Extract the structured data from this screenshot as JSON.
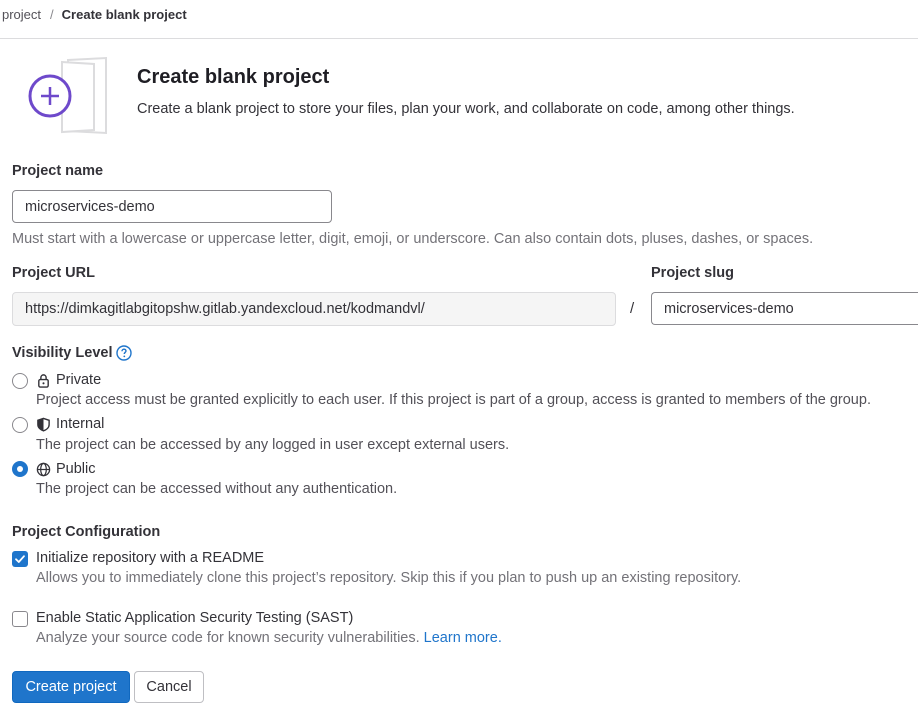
{
  "breadcrumb": {
    "parent": "project",
    "separator": "/",
    "current": "Create blank project"
  },
  "header": {
    "title": "Create blank project",
    "description": "Create a blank project to store your files, plan your work, and collaborate on code, among other things."
  },
  "project_name": {
    "label": "Project name",
    "value": "microservices-demo",
    "help": "Must start with a lowercase or uppercase letter, digit, emoji, or underscore. Can also contain dots, pluses, dashes, or spaces."
  },
  "project_url": {
    "label": "Project URL",
    "value": "https://dimkagitlabgitopshw.gitlab.yandexcloud.net/kodmandvl/",
    "separator": "/"
  },
  "project_slug": {
    "label": "Project slug",
    "value": "microservices-demo"
  },
  "visibility": {
    "label": "Visibility Level",
    "help_icon": "question-circle-icon",
    "options": [
      {
        "label": "Private",
        "icon": "lock-icon",
        "checked": false,
        "description": "Project access must be granted explicitly to each user. If this project is part of a group, access is granted to members of the group."
      },
      {
        "label": "Internal",
        "icon": "shield-icon",
        "checked": false,
        "description": "The project can be accessed by any logged in user except external users."
      },
      {
        "label": "Public",
        "icon": "globe-icon",
        "checked": true,
        "description": "The project can be accessed without any authentication."
      }
    ]
  },
  "configuration": {
    "label": "Project Configuration",
    "readme": {
      "label": "Initialize repository with a README",
      "checked": true,
      "description": "Allows you to immediately clone this project’s repository. Skip this if you plan to push up an existing repository."
    },
    "sast": {
      "label": "Enable Static Application Security Testing (SAST)",
      "checked": false,
      "description": "Analyze your source code for known security vulnerabilities.",
      "link": "Learn more."
    }
  },
  "actions": {
    "create": "Create project",
    "cancel": "Cancel"
  },
  "colors": {
    "primary": "#1f75cb",
    "text": "#333238",
    "muted": "#737278",
    "illustration_purple": "#6e49cb"
  }
}
